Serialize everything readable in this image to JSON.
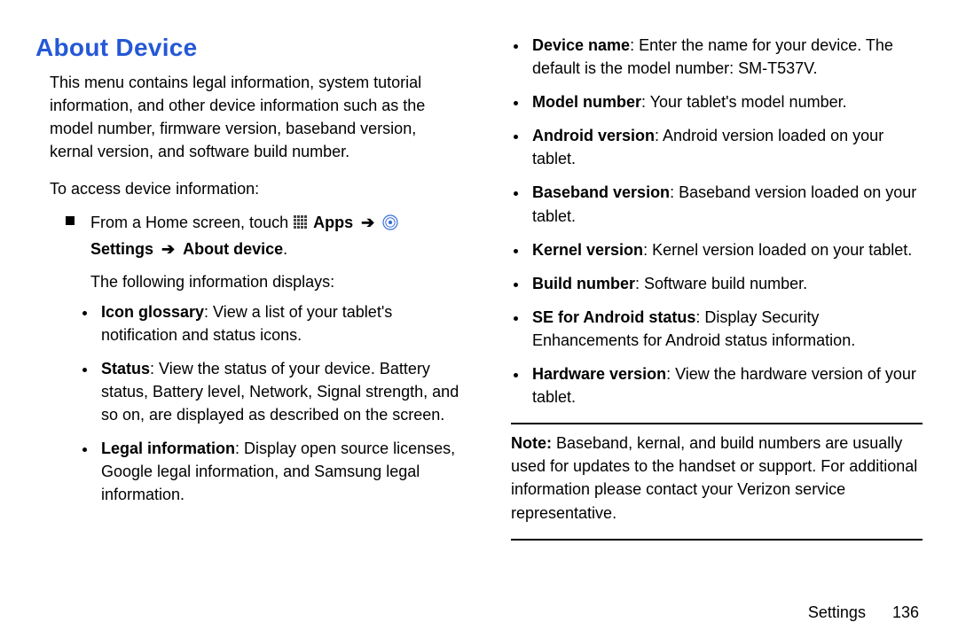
{
  "heading": "About Device",
  "intro": "This menu contains legal information, system tutorial information, and other device information such as the model number, firmware version, baseband version, kernal version, and software build number.",
  "access": "To access device information:",
  "nav": {
    "prefix": "From a Home screen, touch ",
    "arrow": "➔",
    "apps": "Apps",
    "settings": "Settings",
    "about": "About device",
    "period": "."
  },
  "following": "The following information displays:",
  "leftItems": [
    {
      "label": "Icon glossary",
      "desc": ": View a list of your tablet's notification and status icons."
    },
    {
      "label": "Status",
      "desc": ": View the status of your device. Battery status, Battery level, Network, Signal strength, and so on, are displayed as described on the screen."
    },
    {
      "label": "Legal information",
      "desc": ": Display open source licenses, Google legal information, and Samsung legal information."
    }
  ],
  "rightItems": [
    {
      "label": "Device name",
      "desc": ": Enter the name for your device. The default is the model number: SM-T537V."
    },
    {
      "label": "Model number",
      "desc": ": Your tablet's model number."
    },
    {
      "label": "Android version",
      "desc": ": Android version loaded on your tablet."
    },
    {
      "label": "Baseband version",
      "desc": ": Baseband version loaded on your tablet."
    },
    {
      "label": "Kernel version",
      "desc": ": Kernel version loaded on your tablet."
    },
    {
      "label": "Build number",
      "desc": ": Software build number."
    },
    {
      "label": "SE for Android status",
      "desc": ": Display Security Enhancements for Android status information."
    },
    {
      "label": "Hardware version",
      "desc": ": View the hardware version of your tablet."
    }
  ],
  "note": {
    "label": "Note:",
    "text": " Baseband, kernal, and build numbers are usually used for updates to the handset or support. For additional information please contact your Verizon service representative."
  },
  "footer": {
    "section": "Settings",
    "page": "136"
  }
}
